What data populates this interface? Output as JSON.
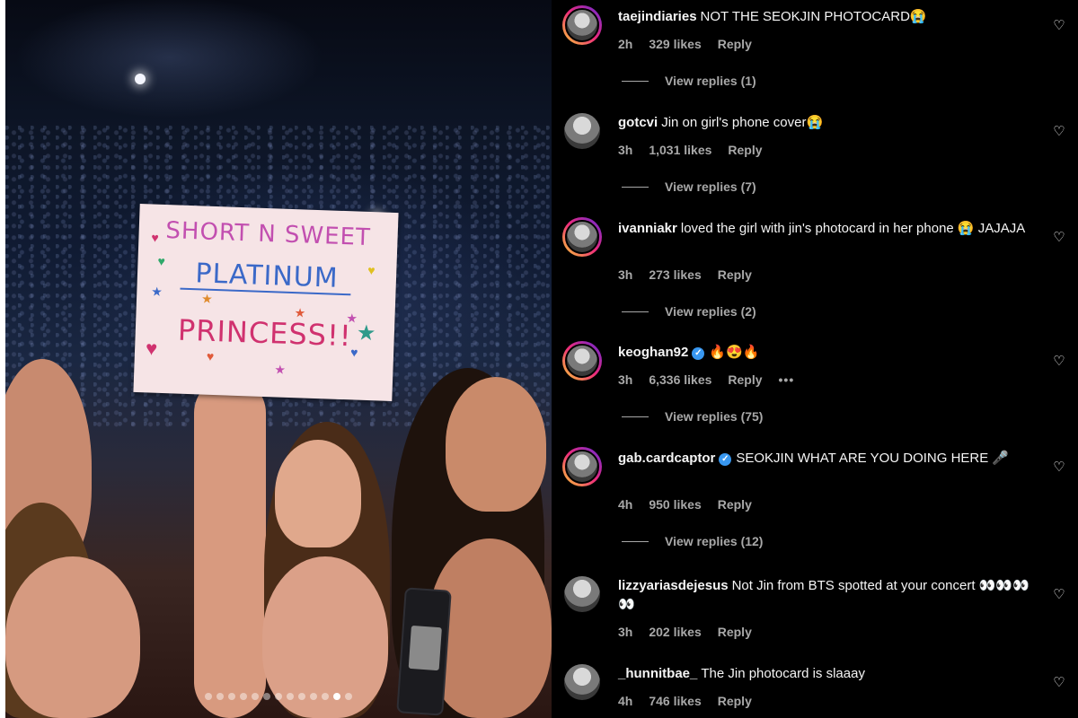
{
  "photo": {
    "sign": {
      "line1": "SHORT N SWEET",
      "line2": "PLATINUM",
      "line3": "PRINCESS!!"
    },
    "carousel": {
      "count": 13,
      "active_index": 11
    }
  },
  "comments": [
    {
      "username": "taejindiaries",
      "verified": false,
      "text": "NOT THE SEOKJIN PHOTOCARD😭",
      "time": "2h",
      "likes": "329 likes",
      "reply": "Reply",
      "view_replies": "View replies (1)",
      "avatar_ring": true
    },
    {
      "username": "gotcvi",
      "verified": false,
      "text": "Jin on girl's phone cover😭",
      "time": "3h",
      "likes": "1,031 likes",
      "reply": "Reply",
      "view_replies": "View replies (7)",
      "avatar_ring": false
    },
    {
      "username": "ivanniakr",
      "verified": false,
      "text": "loved the girl with jin's photocard in her phone 😭 JAJAJA",
      "time": "3h",
      "likes": "273 likes",
      "reply": "Reply",
      "view_replies": "View replies (2)",
      "avatar_ring": true
    },
    {
      "username": "keoghan92",
      "verified": true,
      "text": "🔥😍🔥",
      "time": "3h",
      "likes": "6,336 likes",
      "reply": "Reply",
      "more": "•••",
      "view_replies": "View replies (75)",
      "avatar_ring": true
    },
    {
      "username": "gab.cardcaptor",
      "verified": true,
      "text": "SEOKJIN WHAT ARE YOU DOING HERE 🎤",
      "time": "4h",
      "likes": "950 likes",
      "reply": "Reply",
      "view_replies": "View replies (12)",
      "avatar_ring": true
    },
    {
      "username": "lizzyariasdejesus",
      "verified": false,
      "text": "Not Jin from BTS spotted at your concert 👀👀👀👀",
      "time": "3h",
      "likes": "202 likes",
      "reply": "Reply",
      "avatar_ring": false
    },
    {
      "username": "_hunnitbae_",
      "verified": false,
      "text": "The Jin photocard is slaaay",
      "time": "4h",
      "likes": "746 likes",
      "reply": "Reply",
      "avatar_ring": false
    }
  ],
  "colors": {
    "panel_bg": "#000000",
    "meta_text": "#a8a8a8",
    "verified_blue": "#3897f0"
  }
}
